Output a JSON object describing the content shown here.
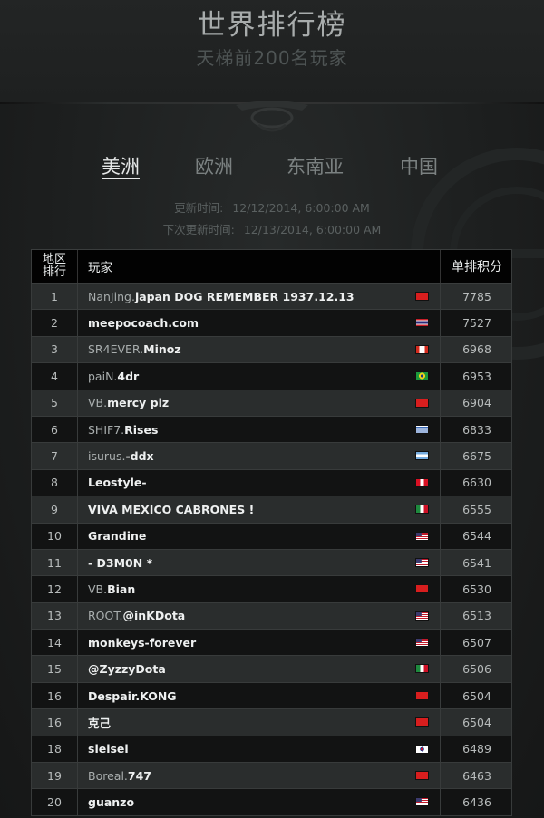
{
  "header": {
    "title": "世界排行榜",
    "subtitle": "天梯前200名玩家"
  },
  "tabs": [
    {
      "label": "美洲",
      "active": true
    },
    {
      "label": "欧洲",
      "active": false
    },
    {
      "label": "东南亚",
      "active": false
    },
    {
      "label": "中国",
      "active": false
    }
  ],
  "update": {
    "last_label": "更新时间:",
    "last_value": "12/12/2014, 6:00:00 AM",
    "next_label": "下次更新时间:",
    "next_value": "12/13/2014, 6:00:00 AM"
  },
  "table": {
    "headers": {
      "rank_line1": "地区",
      "rank_line2": "排行",
      "player": "玩家",
      "score": "单排积分"
    },
    "rows": [
      {
        "rank": "1",
        "prefix": "NanJing.",
        "name": "japan DOG REMEMBER 1937.12.13",
        "flag": "cn",
        "score": "7785"
      },
      {
        "rank": "2",
        "prefix": "",
        "name": "meepocoach.com",
        "flag": "th",
        "score": "7527"
      },
      {
        "rank": "3",
        "prefix": "SR4EVER.",
        "name": "Minoz",
        "flag": "ca",
        "score": "6968"
      },
      {
        "rank": "4",
        "prefix": "paiN.",
        "name": "4dr",
        "flag": "br",
        "score": "6953"
      },
      {
        "rank": "5",
        "prefix": "VB.",
        "name": "mercy plz",
        "flag": "cn",
        "score": "6904"
      },
      {
        "rank": "6",
        "prefix": "SHIF7.",
        "name": "Rises",
        "flag": "uy",
        "score": "6833"
      },
      {
        "rank": "7",
        "prefix": "isurus.",
        "name": "-ddx",
        "flag": "ar",
        "score": "6675"
      },
      {
        "rank": "8",
        "prefix": "",
        "name": "Leostyle-",
        "flag": "pe",
        "score": "6630"
      },
      {
        "rank": "9",
        "prefix": "",
        "name": "VIVA MEXICO CABRONES !",
        "flag": "mx",
        "score": "6555"
      },
      {
        "rank": "10",
        "prefix": "",
        "name": "Grandine",
        "flag": "us",
        "score": "6544"
      },
      {
        "rank": "11",
        "prefix": "",
        "name": "- D3M0N *",
        "flag": "us",
        "score": "6541"
      },
      {
        "rank": "12",
        "prefix": "VB.",
        "name": "Bian",
        "flag": "cn",
        "score": "6530"
      },
      {
        "rank": "13",
        "prefix": "ROOT.",
        "name": "@inKDota",
        "flag": "us",
        "score": "6513"
      },
      {
        "rank": "14",
        "prefix": "",
        "name": "monkeys-forever",
        "flag": "us",
        "score": "6507"
      },
      {
        "rank": "15",
        "prefix": "",
        "name": "@ZyzzyDota",
        "flag": "mx",
        "score": "6506"
      },
      {
        "rank": "16",
        "prefix": "",
        "name": "Despair.KONG",
        "flag": "cn",
        "score": "6504"
      },
      {
        "rank": "16",
        "prefix": "",
        "name": "克己",
        "flag": "cn",
        "score": "6504"
      },
      {
        "rank": "18",
        "prefix": "",
        "name": "sleisel",
        "flag": "kr",
        "score": "6489"
      },
      {
        "rank": "19",
        "prefix": "Boreal.",
        "name": "747",
        "flag": "cn",
        "score": "6463"
      },
      {
        "rank": "20",
        "prefix": "",
        "name": "guanzo",
        "flag": "us",
        "score": "6436"
      }
    ]
  }
}
